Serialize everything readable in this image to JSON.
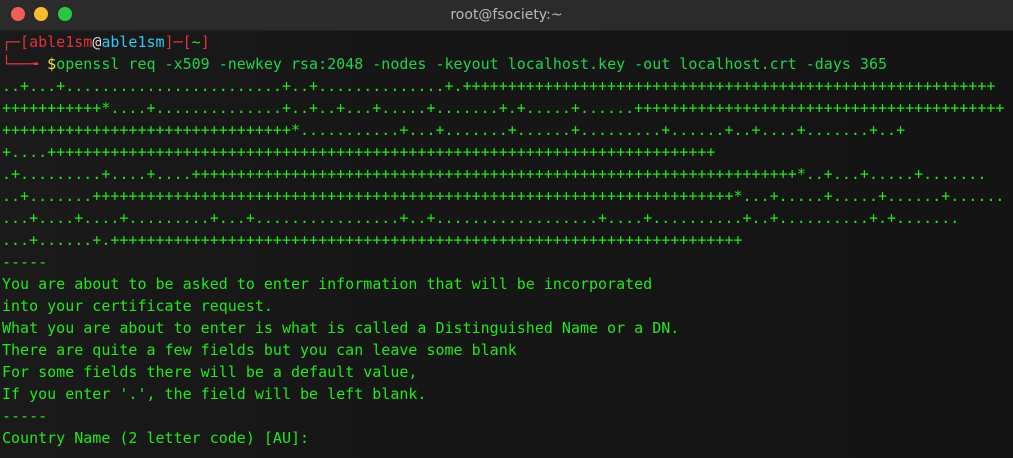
{
  "window": {
    "title": "root@fsociety:~"
  },
  "prompt": {
    "open": "┌─[",
    "user": "able1sm",
    "at": "@",
    "host": "able1sm",
    "sep": "]─[",
    "dir": "~",
    "close": "]",
    "second_prefix": "└──╼ ",
    "dollar": "$",
    "command": "openssl req -x509 -newkey rsa:2048 -nodes -keyout localhost.key -out localhost.crt -days 365"
  },
  "output_lines": [
    "..+...+........................+..+..............+.+++++++++++++++++++++++++++++++++++++++++++++++++++++++++++",
    "+++++++++++*....+..............+..+..+...+.....+.......+.+.....+......+++++++++++++++++++++++++++++++++++++++++",
    "++++++++++++++++++++++++++++++++*...........+...+.......+......+.........+......+..+....+.......+..+",
    "+....++++++++++++++++++++++++++++++++++++++++++++++++++++++++++++++++++++++++++",
    ".+.........+....+....+++++++++++++++++++++++++++++++++++++++++++++++++++++++++++++++++++*..+...+.....+.......",
    "..+.......+++++++++++++++++++++++++++++++++++++++++++++++++++++++++++++++++++++++*...+.....+.....+......+......",
    "...+....+....+.........+...+................+..+..................+....+..........+..+..........+.+.......",
    "...+......+.++++++++++++++++++++++++++++++++++++++++++++++++++++++++++++++++++++++",
    "-----",
    "You are about to be asked to enter information that will be incorporated",
    "into your certificate request.",
    "What you are about to enter is what is called a Distinguished Name or a DN.",
    "There are quite a few fields but you can leave some blank",
    "For some fields there will be a default value,",
    "If you enter '.', the field will be left blank.",
    "-----",
    "Country Name (2 letter code) [AU]:"
  ],
  "colors": {
    "output": "#22e81b",
    "prompt_bracket": "#e0343a",
    "user": "#33c9ee",
    "dollar": "#f0e341"
  }
}
